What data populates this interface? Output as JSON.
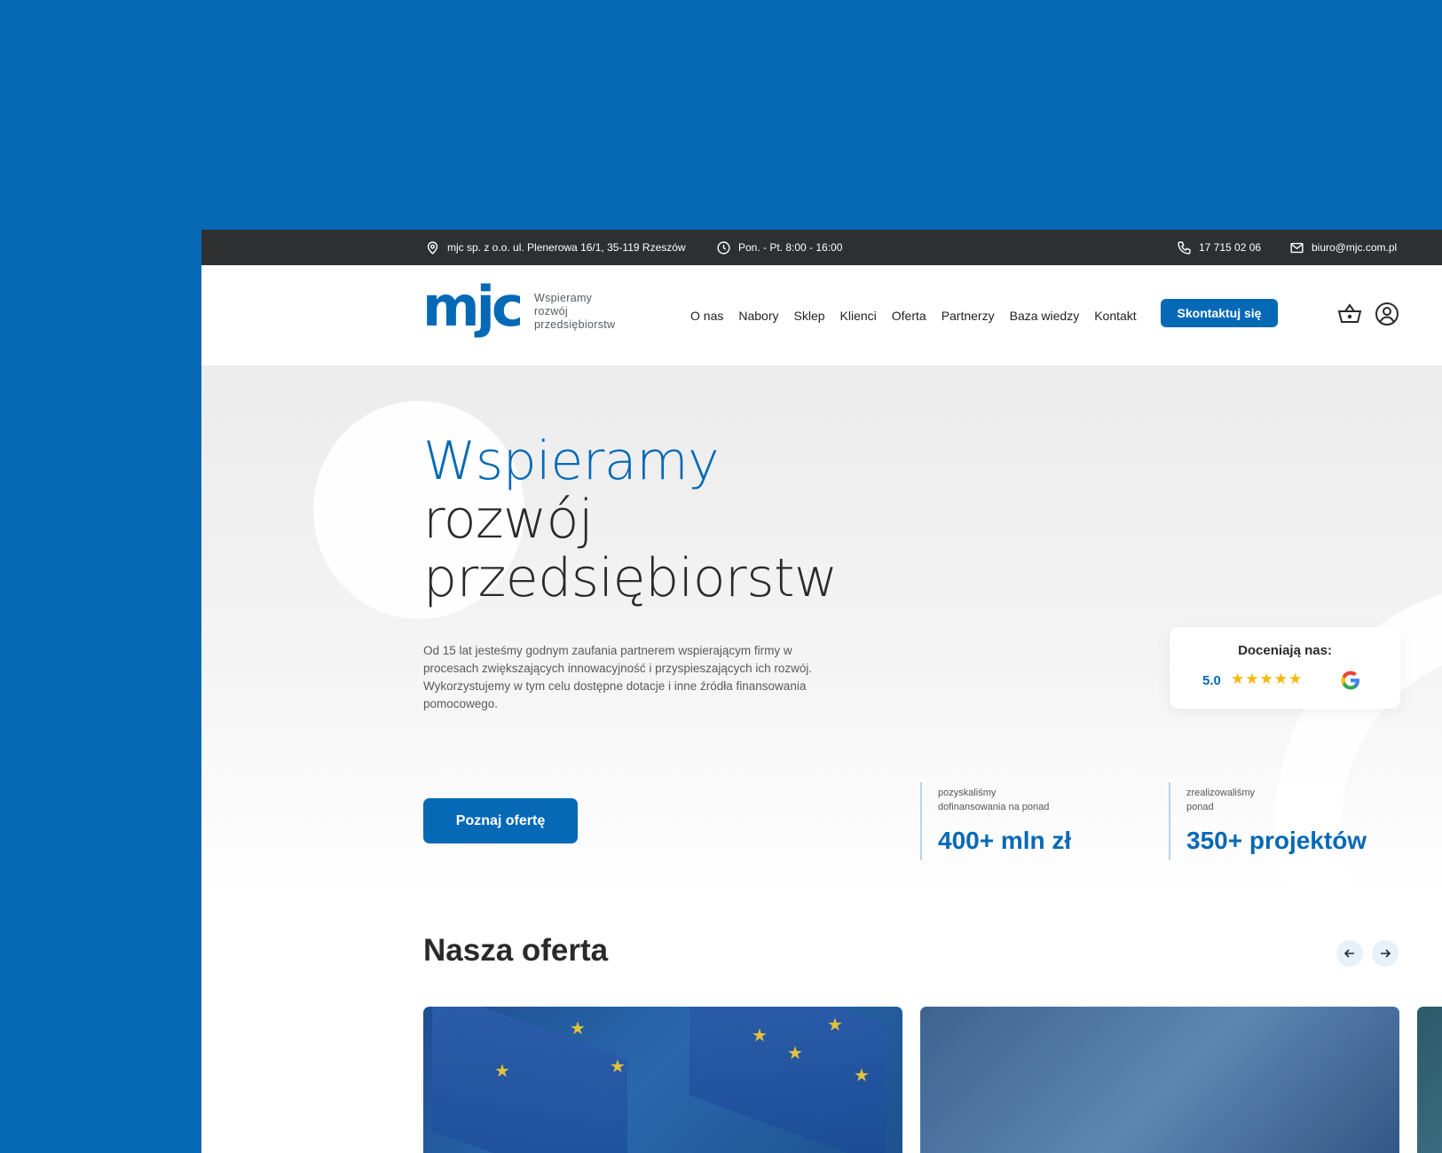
{
  "topbar": {
    "address": "mjc sp. z o.o. ul. Plenerowa 16/1, 35-119 Rzeszów",
    "hours": "Pon. - Pt. 8:00 - 16:00",
    "phone": "17 715 02 06",
    "email": "biuro@mjc.com.pl"
  },
  "header": {
    "logo_text": "mjc",
    "tagline": [
      "Wspieramy",
      "rozwój",
      "przedsiębiorstw"
    ],
    "nav": [
      "O nas",
      "Nabory",
      "Sklep",
      "Klienci",
      "Oferta",
      "Partnerzy",
      "Baza wiedzy",
      "Kontakt"
    ],
    "cta_label": "Skontaktuj się",
    "icons": [
      "basket-icon",
      "user-icon"
    ]
  },
  "hero": {
    "title_line1": "Wspieramy",
    "title_line2": "rozwój",
    "title_line3": "przedsiębiorstw",
    "description": "Od 15 lat jesteśmy godnym zaufania partnerem wspierającym firmy w procesach zwiększających innowacyjność i przyspieszających ich rozwój. Wykorzystujemy w tym celu dostępne dotacje i inne źródła finansowania pomocowego.",
    "button_label": "Poznaj ofertę",
    "rating": {
      "title": "Doceniają nas:",
      "score": "5.0",
      "stars": 5,
      "icon": "google-icon"
    },
    "stats": [
      {
        "label_line1": "pozyskaliśmy",
        "label_line2": "dofinansowania na ponad",
        "value": "400+ mln zł"
      },
      {
        "label_line1": "zrealizowaliśmy",
        "label_line2": "ponad",
        "value": "350+ projektów"
      }
    ]
  },
  "offer": {
    "title": "Nasza oferta",
    "prev_icon": "arrow-left-icon",
    "next_icon": "arrow-right-icon"
  },
  "colors": {
    "brand_blue": "#0569b6",
    "topbar_bg": "#2e2f31",
    "star_yellow": "#f6b800"
  }
}
